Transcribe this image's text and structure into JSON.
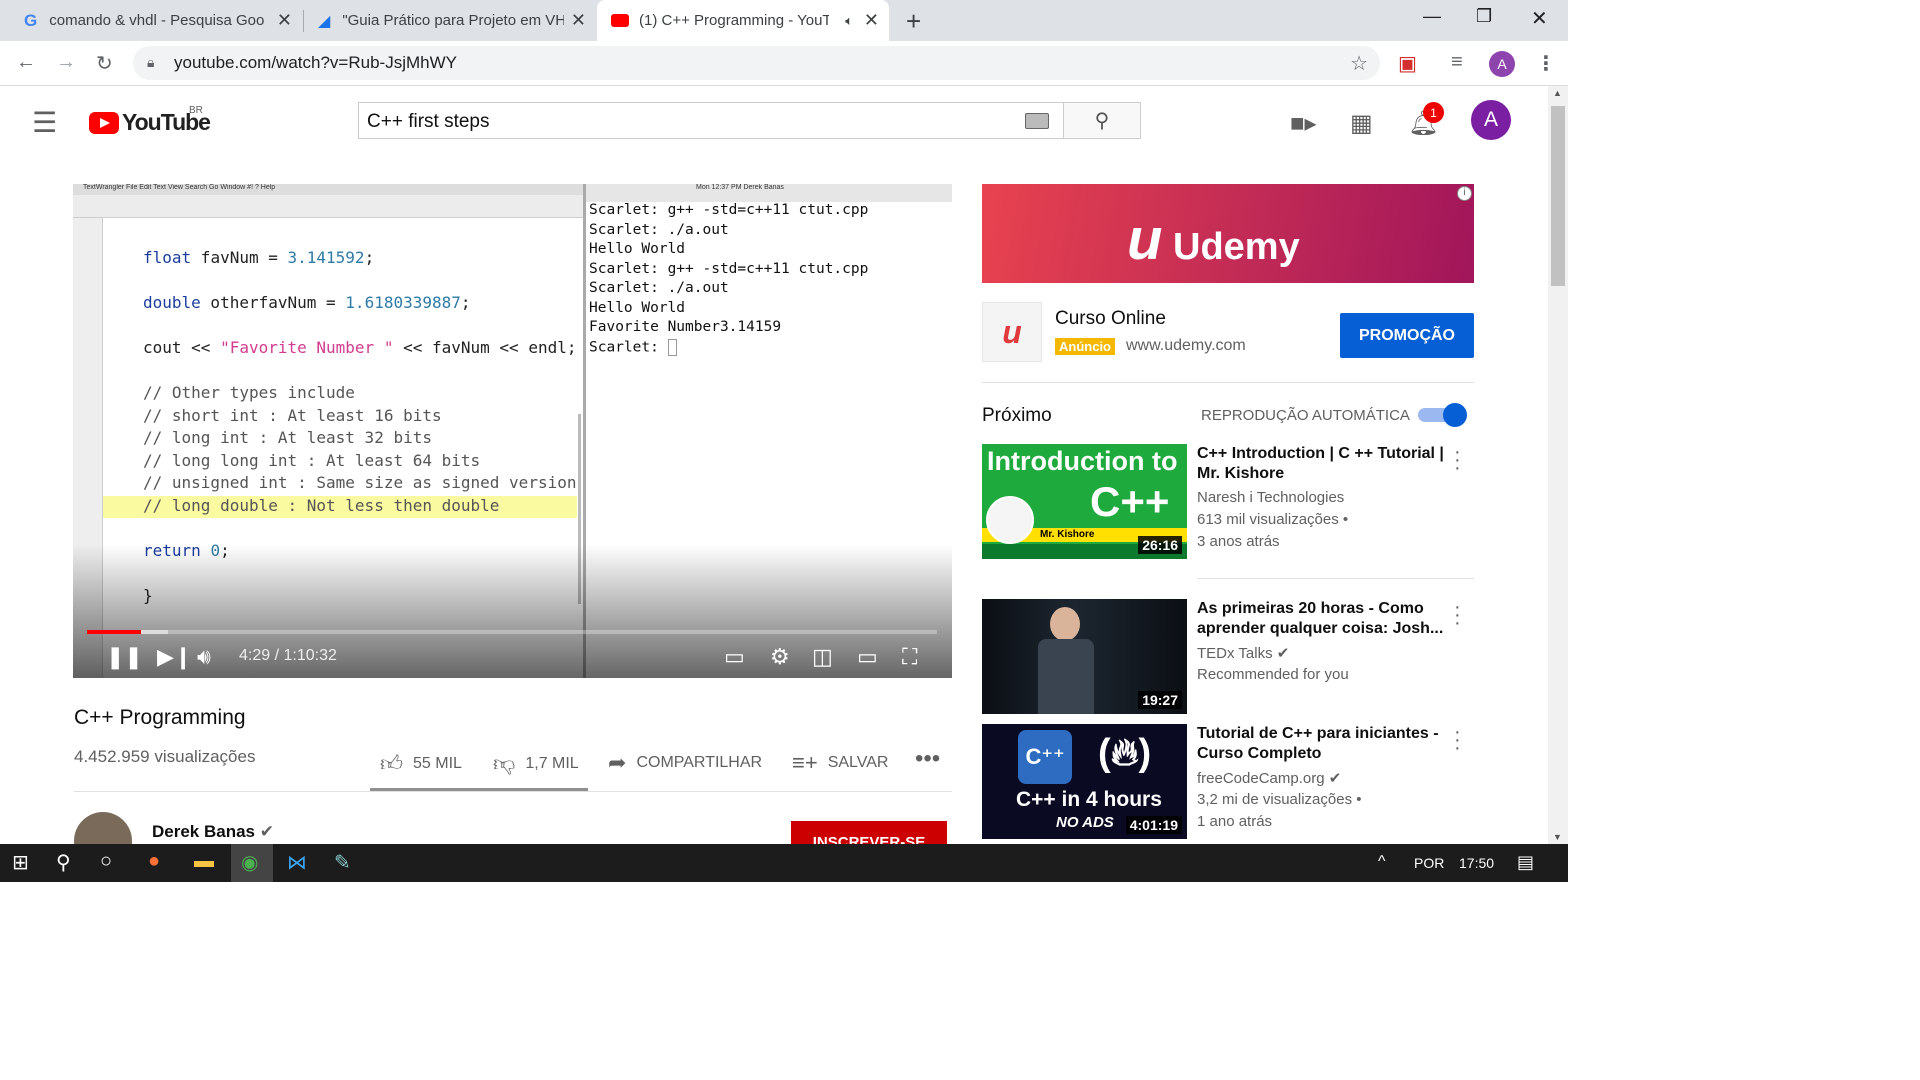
{
  "browser": {
    "tabs": [
      {
        "label": "comando & vhdl - Pesquisa Goo",
        "icon": "google-icon"
      },
      {
        "label": "\"Guia Prático para Projeto em VH",
        "icon": "document-icon"
      },
      {
        "label": "(1) C++ Programming - YouT",
        "icon": "youtube-icon",
        "active": true
      }
    ],
    "url": "youtube.com/watch?v=Rub-JsjMhWY",
    "profile_initial": "A"
  },
  "youtube": {
    "region": "BR",
    "search_value": "C++ first steps",
    "notification_count": "1",
    "avatar_initial": "A"
  },
  "player": {
    "time": "4:29 / 1:10:32",
    "progress_fraction": 0.064,
    "buffered_fraction": 0.095,
    "editor_menu": "TextWrangler   File   Edit   Text   View   Search   Go   Window   #!   ?   Help",
    "terminal_title": "Mon 12:37 PM   Derek Banas",
    "code_lines": [
      "float favNum = 3.141592;",
      "",
      "double otherfavNum = 1.6180339887;",
      "",
      "cout << \"Favorite Number \" << favNum << endl;",
      "",
      "// Other types include",
      "// short int : At least 16 bits",
      "// long int : At least 32 bits",
      "// long long int : At least 64 bits",
      "// unsigned int : Same size as signed version",
      "// long double : Not less then double",
      "",
      "return 0;",
      "",
      "}"
    ],
    "terminal_lines": [
      "Scarlet: g++ -std=c++11 ctut.cpp",
      "Scarlet: ./a.out",
      "Hello World",
      "Scarlet: g++ -std=c++11 ctut.cpp",
      "Scarlet: ./a.out",
      "Hello World",
      "Favorite Number3.14159",
      "Scarlet: "
    ]
  },
  "video": {
    "title": "C++ Programming",
    "views": "4.452.959 visualizações",
    "likes": "55 MIL",
    "dislikes": "1,7 MIL",
    "share": "COMPARTILHAR",
    "save": "SALVAR",
    "channel": "Derek Banas",
    "subscribe": "INSCREVER-SE"
  },
  "ad": {
    "banner_text": "Udemy",
    "title": "Curso Online",
    "badge": "Anúncio",
    "url": "www.udemy.com",
    "button": "PROMOÇÃO"
  },
  "sidebar": {
    "next_label": "Próximo",
    "autoplay_label": "REPRODUÇÃO AUTOMÁTICA",
    "autoplay_on": true,
    "videos": [
      {
        "title": "C++ Introduction | C ++ Tutorial | Mr. Kishore",
        "channel": "Naresh i Technologies",
        "views": "613 mil visualizações •",
        "age": "3 anos atrás",
        "duration": "26:16",
        "thumb_text_1": "Introduction to",
        "thumb_text_2": "C++",
        "thumb_text_3": "Mr. Kishore"
      },
      {
        "title": "As primeiras 20 horas - Como aprender qualquer coisa: Josh...",
        "channel": "TEDx Talks",
        "views": "Recommended for you",
        "age": "",
        "duration": "19:27"
      },
      {
        "title": "Tutorial de C++ para iniciantes - Curso Completo",
        "channel": "freeCodeCamp.org",
        "views": "3,2 mi de visualizações •",
        "age": "1 ano atrás",
        "duration": "4:01:19",
        "thumb_text_1": "C++ in 4 hours",
        "thumb_text_2": "NO ADS"
      }
    ]
  },
  "taskbar": {
    "lang": "POR",
    "time": "17:50"
  }
}
